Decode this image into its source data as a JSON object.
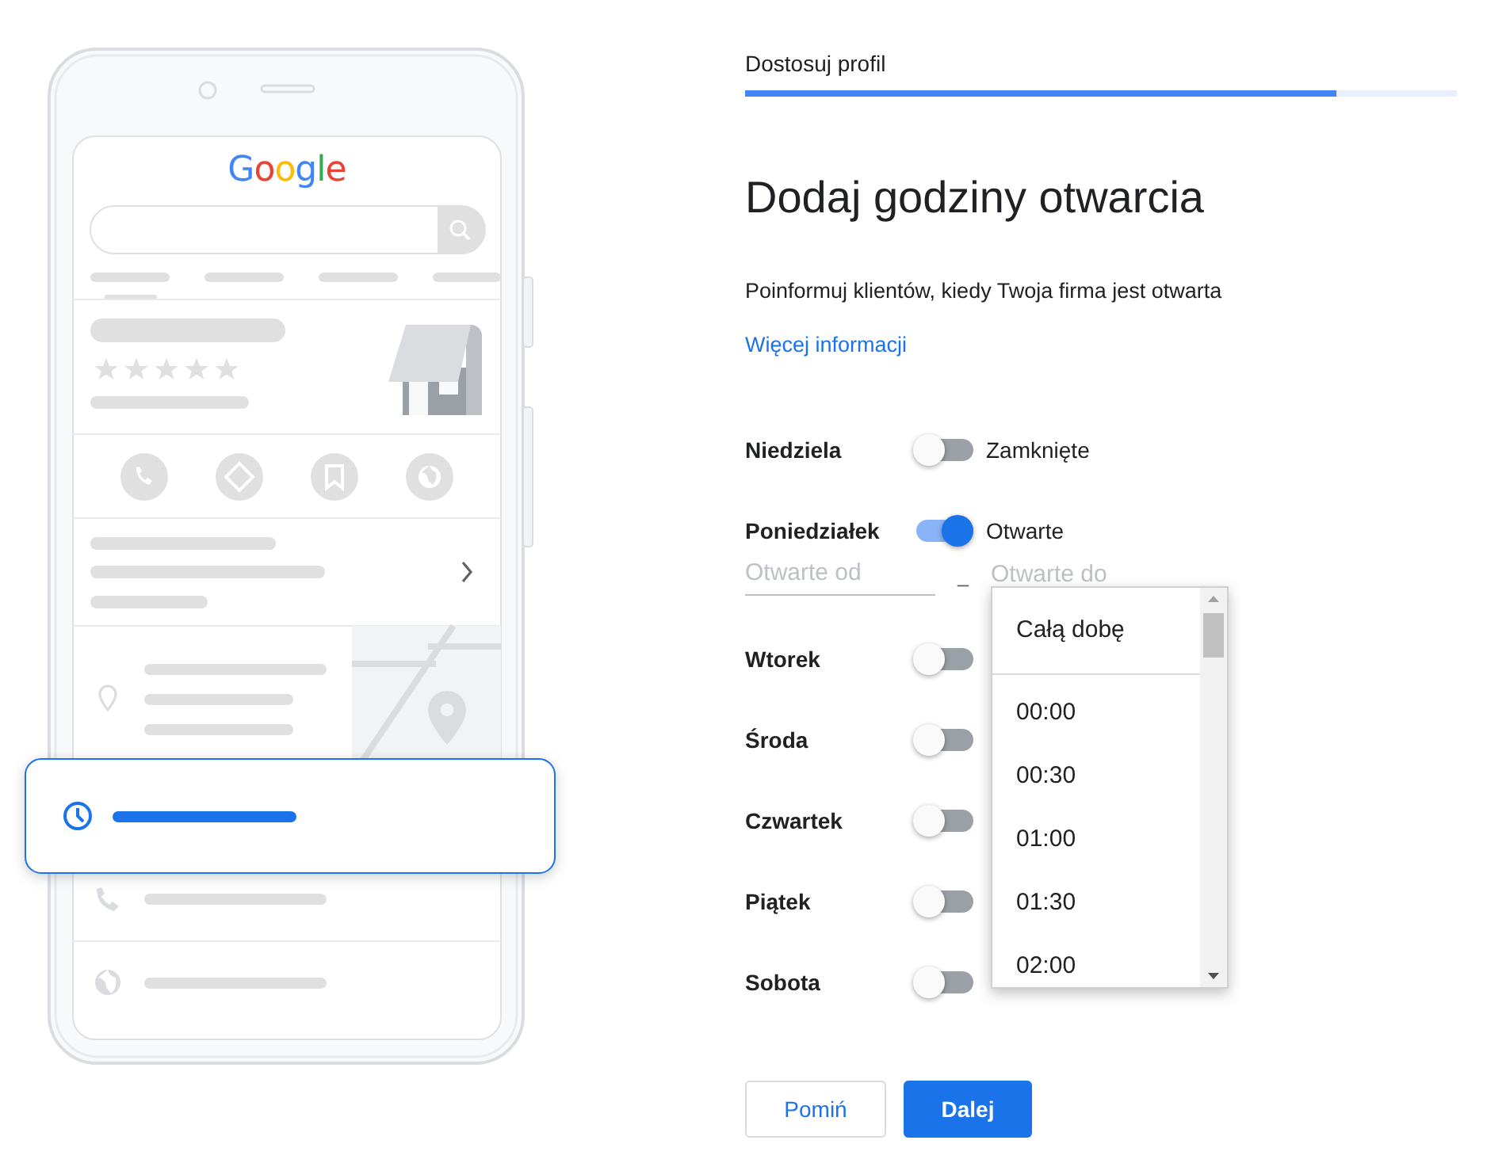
{
  "illustration": {
    "logo": "Google"
  },
  "header": {
    "step": "Dostosuj profil",
    "level": 0.83
  },
  "title": "Dodaj godziny otwarcia",
  "subtitle": "Poinformuj klientów, kiedy Twoja firma jest otwarta",
  "link": "Więcej informacji",
  "days": [
    {
      "name": "Niedziela",
      "open": false,
      "status": "Zamknięte"
    },
    {
      "name": "Poniedziałek",
      "open": true,
      "status": "Otwarte",
      "from_placeholder": "Otwarte od",
      "separator": "–",
      "to_placeholder": "Otwarte do"
    },
    {
      "name": "Wtorek",
      "open": false
    },
    {
      "name": "Środa",
      "open": false
    },
    {
      "name": "Czwartek",
      "open": false
    },
    {
      "name": "Piątek",
      "open": false
    },
    {
      "name": "Sobota",
      "open": false
    }
  ],
  "dropdown": {
    "options": [
      {
        "label": "Całą dobę",
        "kind": "special"
      },
      {
        "label": "00:00",
        "kind": "time"
      },
      {
        "label": "00:30",
        "kind": "time"
      },
      {
        "label": "01:00",
        "kind": "time"
      },
      {
        "label": "01:30",
        "kind": "time"
      },
      {
        "label": "02:00",
        "kind": "time"
      }
    ]
  },
  "buttons": [
    {
      "label": "Pomiń",
      "kind": "secondary"
    },
    {
      "label": "Dalej",
      "kind": "primary"
    }
  ]
}
